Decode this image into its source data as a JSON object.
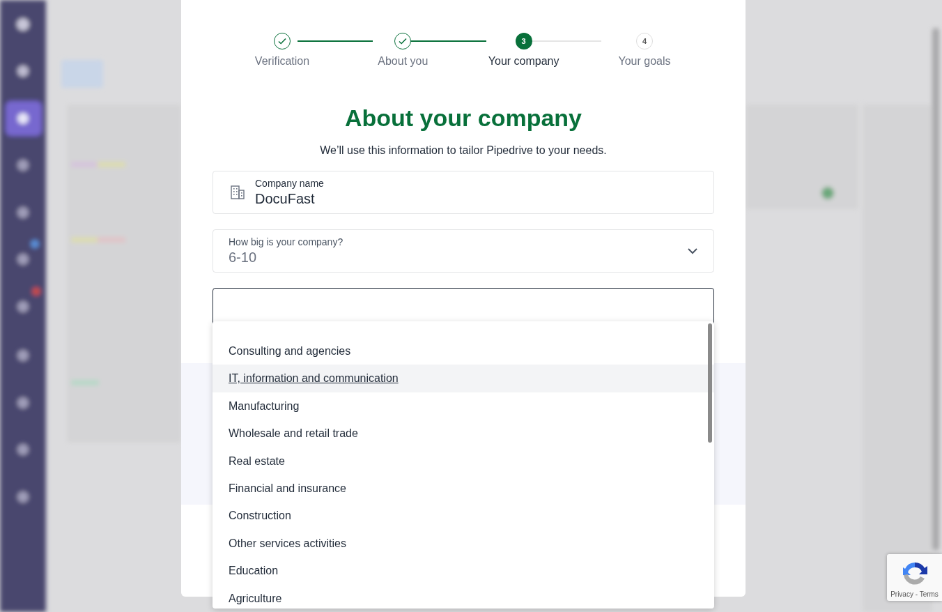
{
  "steps": [
    {
      "label": "Verification",
      "completed": true,
      "selected": false
    },
    {
      "label": "About you",
      "completed": true,
      "selected": false
    },
    {
      "label": "Your company",
      "completed": false,
      "selected": true,
      "number": "3"
    },
    {
      "label": "Your goals",
      "completed": false,
      "selected": false,
      "number": "4"
    }
  ],
  "heading": "About your company",
  "subtitle": "We’ll use this information to tailor Pipedrive to your needs.",
  "fields": [
    {
      "kind": "text",
      "label": "Company name",
      "value": "DocuFast",
      "focused": false
    },
    {
      "kind": "select",
      "label": "How big is your company?",
      "value": "6-10",
      "focused": false
    },
    {
      "kind": "select",
      "focused": true
    }
  ],
  "dropdown": {
    "options": [
      {
        "label": "Consulting and agencies",
        "highlighted": false
      },
      {
        "label": "IT, information and communication",
        "highlighted": true
      },
      {
        "label": "Manufacturing",
        "highlighted": false
      },
      {
        "label": "Wholesale and retail trade",
        "highlighted": false
      },
      {
        "label": "Real estate",
        "highlighted": false
      },
      {
        "label": "Financial and insurance",
        "highlighted": false
      },
      {
        "label": "Construction",
        "highlighted": false
      },
      {
        "label": "Other services activities",
        "highlighted": false
      },
      {
        "label": "Education",
        "highlighted": false
      },
      {
        "label": "Agriculture",
        "highlighted": false
      }
    ]
  },
  "recaptcha": {
    "links": "Privacy - Terms"
  }
}
